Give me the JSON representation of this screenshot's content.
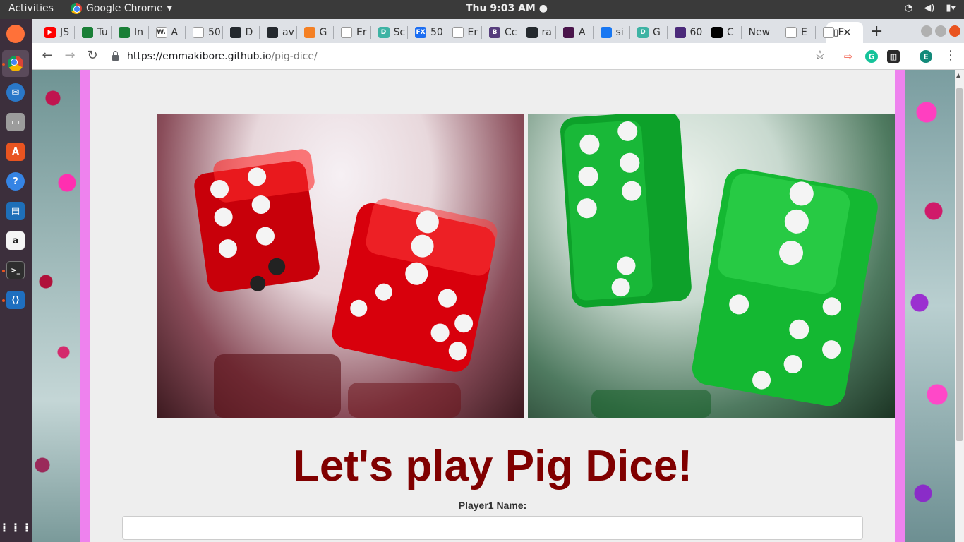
{
  "topbar": {
    "activities": "Activities",
    "app_name": "Google Chrome",
    "clock": "Thu  9:03 AM ●"
  },
  "launcher": [
    "firefox-icon",
    "chrome-icon",
    "thunderbird-icon",
    "files-icon",
    "software-icon",
    "help-icon",
    "writer-icon",
    "amazon-icon",
    "terminal-icon",
    "vscode-icon",
    "apps-grid-icon"
  ],
  "tabs": [
    {
      "label": "JS",
      "color": "#ff0000",
      "glyph": "▶"
    },
    {
      "label": "Tu",
      "color": "#1a7f37",
      "glyph": ""
    },
    {
      "label": "In",
      "color": "#1a7f37",
      "glyph": ""
    },
    {
      "label": "A",
      "color": "#ffffff",
      "glyph": "W."
    },
    {
      "label": "50",
      "color": "#ffffff",
      "glyph": ""
    },
    {
      "label": "D",
      "color": "#24292e",
      "glyph": ""
    },
    {
      "label": "av",
      "color": "#24292e",
      "glyph": ""
    },
    {
      "label": "G",
      "color": "#f48024",
      "glyph": ""
    },
    {
      "label": "Er",
      "color": "#ffffff",
      "glyph": ""
    },
    {
      "label": "Sc",
      "color": "#3eb3a4",
      "glyph": "D"
    },
    {
      "label": "50",
      "color": "#1c6ef2",
      "glyph": "FX"
    },
    {
      "label": "Er",
      "color": "#ffffff",
      "glyph": ""
    },
    {
      "label": "Cc",
      "color": "#563d7c",
      "glyph": "B"
    },
    {
      "label": "ra",
      "color": "#24292e",
      "glyph": ""
    },
    {
      "label": "A",
      "color": "#4a154b",
      "glyph": ""
    },
    {
      "label": "si",
      "color": "#1877f2",
      "glyph": ""
    },
    {
      "label": "G",
      "color": "#3eb3a4",
      "glyph": "D"
    },
    {
      "label": "60",
      "color": "#4b2a7a",
      "glyph": ""
    },
    {
      "label": "C",
      "color": "#000000",
      "glyph": ""
    },
    {
      "label": "New",
      "color": "",
      "glyph": ""
    },
    {
      "label": "E",
      "color": "#ffffff",
      "glyph": ""
    },
    {
      "label": "E",
      "color": "#ffffff",
      "glyph": ""
    }
  ],
  "address": {
    "host": "https://emmakibore.github.io",
    "path": "/pig-dice/"
  },
  "profile_initial": "E",
  "page": {
    "heading": "Let's play Pig Dice!",
    "player1_label": "Player1 Name:",
    "player1_value": ""
  }
}
